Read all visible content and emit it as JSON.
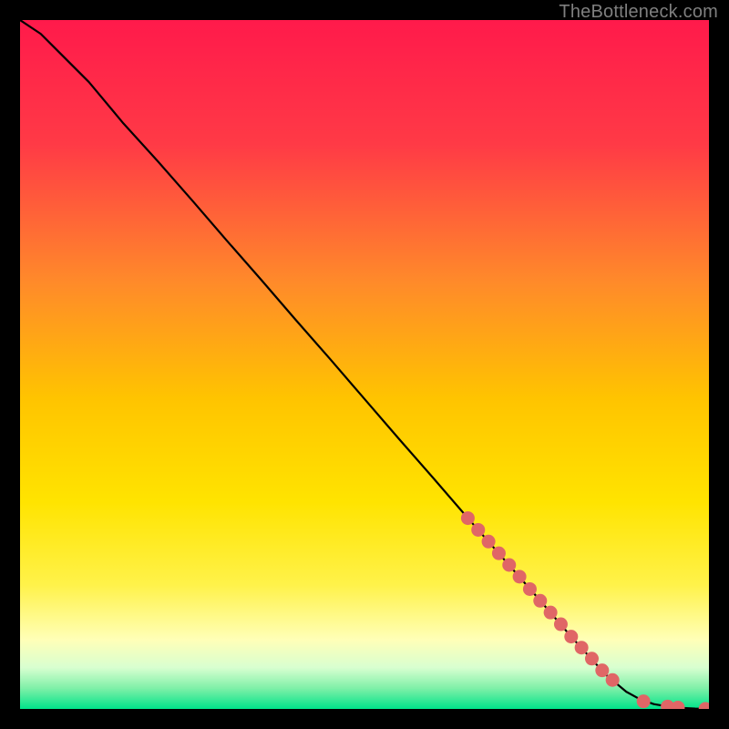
{
  "attribution": "TheBottleneck.com",
  "colors": {
    "gradient_top": "#ff1a4b",
    "gradient_mid_upper": "#ff7a2a",
    "gradient_mid": "#ffd400",
    "gradient_mid_lower": "#ffe93a",
    "gradient_pale": "#ffffb0",
    "gradient_green1": "#9cf29c",
    "gradient_green2": "#00e38a",
    "line": "#000000",
    "marker": "#e06666",
    "frame": "#000000",
    "attribution": "#7f7f7f"
  },
  "chart_data": {
    "type": "line",
    "title": "",
    "xlabel": "",
    "ylabel": "",
    "xlim": [
      0,
      100
    ],
    "ylim": [
      0,
      100
    ],
    "series": [
      {
        "name": "curve",
        "x": [
          0,
          3,
          6,
          10,
          15,
          20,
          25,
          30,
          35,
          40,
          45,
          50,
          55,
          60,
          65,
          70,
          75,
          80,
          85,
          88,
          90,
          92,
          94,
          96,
          98,
          100
        ],
        "y": [
          100,
          98,
          95,
          91,
          85,
          79.5,
          73.8,
          68,
          62.3,
          56.5,
          50.8,
          45,
          39.2,
          33.5,
          27.7,
          22,
          16.3,
          10.5,
          5.0,
          2.5,
          1.4,
          0.7,
          0.35,
          0.15,
          0.05,
          0.0
        ]
      }
    ],
    "markers": {
      "name": "highlight-points",
      "x": [
        65,
        66.5,
        68,
        69.5,
        71,
        72.5,
        74,
        75.5,
        77,
        78.5,
        80,
        81.5,
        83,
        84.5,
        86,
        90.5,
        94,
        95.5,
        99.5
      ],
      "y": [
        27.7,
        26.0,
        24.3,
        22.6,
        20.9,
        19.2,
        17.4,
        15.7,
        14.0,
        12.3,
        10.5,
        8.9,
        7.3,
        5.6,
        4.2,
        1.1,
        0.35,
        0.2,
        0.02
      ]
    }
  }
}
